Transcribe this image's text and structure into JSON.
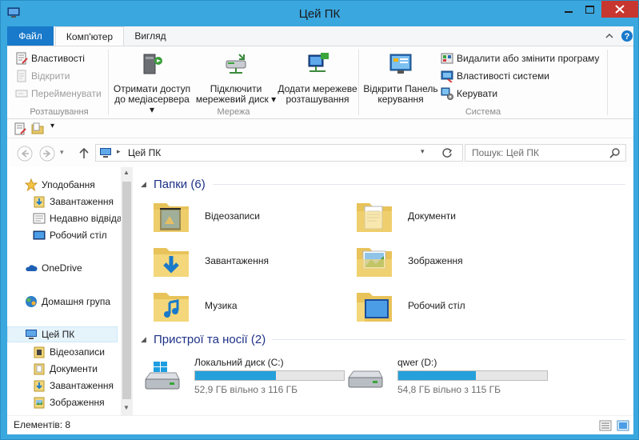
{
  "window": {
    "title": "Цей ПК"
  },
  "ribbon_tabs": {
    "file": "Файл",
    "computer": "Комп'ютер",
    "view": "Вигляд"
  },
  "ribbon": {
    "location": {
      "label": "Розташування",
      "properties": "Властивості",
      "open": "Відкрити",
      "rename": "Перейменувати"
    },
    "network": {
      "label": "Мережа",
      "media_line1": "Отримати доступ",
      "media_line2": "до медіасервера",
      "map_line1": "Підключити",
      "map_line2": "мережевий диск",
      "add_line1": "Додати мережеве",
      "add_line2": "розташування"
    },
    "system": {
      "label": "Система",
      "control_line1": "Відкрити Панель",
      "control_line2": "керування",
      "uninstall": "Видалити або змінити програму",
      "sys_props": "Властивості системи",
      "manage": "Керувати"
    }
  },
  "address": {
    "location": "Цей ПК",
    "search_placeholder": "Пошук: Цей ПК"
  },
  "nav": {
    "favorites": "Уподобання",
    "fav_items": [
      "Завантаження",
      "Недавно відвідані",
      "Робочий стіл"
    ],
    "onedrive": "OneDrive",
    "homegroup": "Домашня група",
    "thispc": "Цей ПК",
    "pc_items": [
      "Відеозаписи",
      "Документи",
      "Завантаження",
      "Зображення"
    ]
  },
  "content": {
    "folders_header": "Папки (6)",
    "folders": [
      "Відеозаписи",
      "Документи",
      "Завантаження",
      "Зображення",
      "Музика",
      "Робочий стіл"
    ],
    "devices_header": "Пристрої та носії (2)",
    "drives": [
      {
        "name": "Локальний диск (C:)",
        "free": "52,9 ГБ вільно з 116 ГБ",
        "used_fraction": 0.544
      },
      {
        "name": "qwer (D:)",
        "free": "54,8 ГБ вільно з 115 ГБ",
        "used_fraction": 0.523
      }
    ]
  },
  "status": {
    "items": "Елементів: 8"
  },
  "colors": {
    "accent": "#1979ca",
    "titlebar": "#3aa7df",
    "close": "#c7372f",
    "drive_fill": "#26a0da"
  }
}
